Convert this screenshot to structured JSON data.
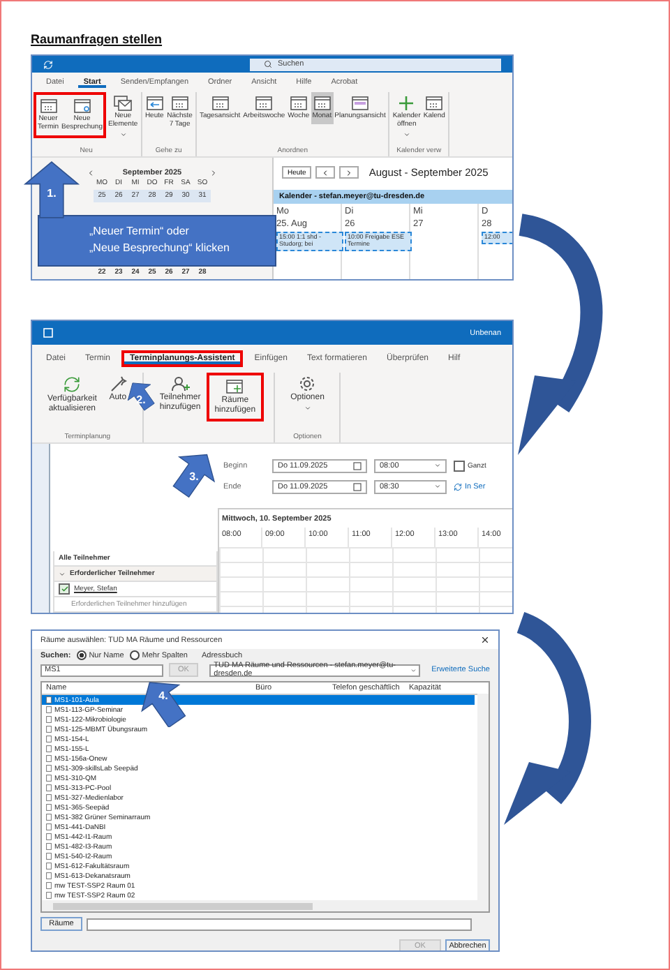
{
  "title": "Raumanfragen stellen",
  "outlook": {
    "search": {
      "placeholder": "Suchen"
    },
    "tabs": [
      {
        "label": "Datei",
        "selected": false
      },
      {
        "label": "Start",
        "selected": true
      },
      {
        "label": "Senden/Empfangen",
        "selected": false
      },
      {
        "label": "Ordner",
        "selected": false
      },
      {
        "label": "Ansicht",
        "selected": false
      },
      {
        "label": "Hilfe",
        "selected": false
      },
      {
        "label": "Acrobat",
        "selected": false
      }
    ],
    "ribbon": [
      {
        "label": "Neu",
        "buttons": [
          {
            "label": "Neuer\nTermin",
            "kind": "calendar",
            "selected": false,
            "highlighted": true
          },
          {
            "label": "Neue\nBesprechung",
            "kind": "meeting",
            "selected": false,
            "highlighted": true
          },
          {
            "label": "Neue\nElemente",
            "kind": "items",
            "selected": false,
            "highlighted": false,
            "dropdown": true
          }
        ]
      },
      {
        "label": "Gehe zu",
        "buttons": [
          {
            "label": "Heute",
            "kind": "today",
            "selected": false,
            "highlighted": false
          },
          {
            "label": "Nächste\n7 Tage",
            "kind": "calendar",
            "selected": false,
            "highlighted": false
          }
        ]
      },
      {
        "label": "Anordnen",
        "buttons": [
          {
            "label": "Tagesansicht",
            "kind": "calendar",
            "selected": false,
            "highlighted": false
          },
          {
            "label": "Arbeitswoche",
            "kind": "calendar",
            "selected": false,
            "highlighted": false
          },
          {
            "label": "Woche",
            "kind": "calendar",
            "selected": false,
            "highlighted": false
          },
          {
            "label": "Monat",
            "kind": "calendar",
            "selected": true,
            "highlighted": false
          },
          {
            "label": "Planungsansicht",
            "kind": "plan",
            "selected": false,
            "highlighted": false
          }
        ]
      },
      {
        "label": "Kalender verw",
        "buttons": [
          {
            "label": "Kalender\nöffnen",
            "kind": "add",
            "selected": false,
            "highlighted": false,
            "dropdown": true
          },
          {
            "label": "Kalend",
            "kind": "calendar",
            "selected": false,
            "highlighted": false
          }
        ]
      }
    ],
    "mini_calendar": {
      "title": "September 2025",
      "weekdays": [
        "MO",
        "DI",
        "MI",
        "DO",
        "FR",
        "SA",
        "SO"
      ],
      "weeks": [
        [
          "25",
          "26",
          "27",
          "28",
          "29",
          "30",
          "31"
        ],
        [
          "22",
          "23",
          "24",
          "25",
          "26",
          "27",
          "28"
        ]
      ]
    },
    "calendar": {
      "today_button": "Heute",
      "range": "August - September 2025",
      "account": "Kalender - stefan.meyer@tu-dresden.de",
      "days": [
        {
          "name": "Mo",
          "date": "25. Aug",
          "events": [
            "15:00 1:1 shd - Studorg; bei"
          ]
        },
        {
          "name": "Di",
          "date": "26",
          "events": [
            "10:00 Freigabe ESE Termine"
          ]
        },
        {
          "name": "Mi",
          "date": "27"
        },
        {
          "name": "D",
          "date": "28",
          "events": [
            "12:00"
          ]
        }
      ]
    }
  },
  "note": "„Neuer Termin“ oder\n„Neue Besprechung“ klicken",
  "callouts": [
    {
      "number": "1."
    },
    {
      "number": "2."
    },
    {
      "number": "3."
    },
    {
      "number": "4."
    }
  ],
  "meeting": {
    "window_title": "Unbenan",
    "tabs": [
      {
        "label": "Datei",
        "selected": false,
        "highlighted": false
      },
      {
        "label": "Termin",
        "selected": false,
        "highlighted": false
      },
      {
        "label": "Terminplanungs-Assistent",
        "selected": true,
        "highlighted": true
      },
      {
        "label": "Einfügen",
        "selected": false,
        "highlighted": false
      },
      {
        "label": "Text formatieren",
        "selected": false,
        "highlighted": false
      },
      {
        "label": "Überprüfen",
        "selected": false,
        "highlighted": false
      },
      {
        "label": "Hilf",
        "selected": false,
        "highlighted": false
      }
    ],
    "ribbon": [
      {
        "label": "Terminplanung",
        "buttons": [
          {
            "label": "Verfügbarkeit\naktualisieren",
            "kind": "refresh",
            "selected": false,
            "highlighted": false
          },
          {
            "label": "Auto",
            "kind": "wand",
            "selected": false,
            "highlighted": false
          }
        ]
      },
      {
        "buttons": [
          {
            "label": "Teilnehmer\nhinzufügen",
            "kind": "person",
            "selected": false,
            "highlighted": false
          },
          {
            "label": "Räume\nhinzufügen",
            "kind": "room",
            "selected": false,
            "highlighted": true
          }
        ]
      },
      {
        "label": "Optionen",
        "buttons": [
          {
            "label": "Optionen",
            "kind": "gear",
            "selected": false,
            "highlighted": false,
            "dropdown": true
          }
        ]
      }
    ],
    "start": {
      "label": "Beginn",
      "date": "Do 11.09.2025",
      "time": "08:00"
    },
    "end": {
      "label": "Ende",
      "date": "Do 11.09.2025",
      "time": "08:30"
    },
    "all_day": {
      "label": "Ganzt",
      "checked": false
    },
    "recurrence": "In Ser",
    "schedule": {
      "date": "Mittwoch, 10. September 2025",
      "hours": [
        "08:00",
        "09:00",
        "10:00",
        "11:00",
        "12:00",
        "13:00",
        "14:00"
      ]
    },
    "attendees": {
      "header": "Alle Teilnehmer",
      "group": {
        "label": "Erforderlicher Teilnehmer",
        "expanded": true
      },
      "people": [
        {
          "name": "Meyer, Stefan",
          "checked": true
        }
      ],
      "add_hint": "Erforderlichen Teilnehmer hinzufügen"
    }
  },
  "dialog": {
    "title": "Räume auswählen: TUD MA Räume und Ressourcen",
    "search_label": "Suchen:",
    "modes": [
      {
        "label": "Nur Name",
        "selected": true
      },
      {
        "label": "Mehr Spalten",
        "selected": false
      }
    ],
    "address_book_label": "Adressbuch",
    "query": "MS1",
    "go_button": {
      "label": "OK",
      "disabled": true
    },
    "address_book": "TUD MA Räume und Ressourcen - stefan.meyer@tu-dresden.de",
    "advanced_link": "Erweiterte Suche",
    "columns": [
      "Name",
      "Büro",
      "Telefon geschäftlich",
      "Kapazität"
    ],
    "rooms": [
      {
        "name": "MS1-101-Aula",
        "selected": true
      },
      {
        "name": "MS1-113-GP-Seminar",
        "selected": false
      },
      {
        "name": "MS1-122-Mikrobiologie",
        "selected": false
      },
      {
        "name": "MS1-125-MBMT Übungsraum",
        "selected": false
      },
      {
        "name": "MS1-154-L",
        "selected": false
      },
      {
        "name": "MS1-155-L",
        "selected": false
      },
      {
        "name": "MS1-156a-Onew",
        "selected": false
      },
      {
        "name": "MS1-309-skillsLab Seepäd",
        "selected": false
      },
      {
        "name": "MS1-310-QM",
        "selected": false
      },
      {
        "name": "MS1-313-PC-Pool",
        "selected": false
      },
      {
        "name": "MS1-327-Medienlabor",
        "selected": false
      },
      {
        "name": "MS1-365-Seepäd",
        "selected": false
      },
      {
        "name": "MS1-382 Grüner Seminarraum",
        "selected": false
      },
      {
        "name": "MS1-441-DaNBI",
        "selected": false
      },
      {
        "name": "MS1-442-I1-Raum",
        "selected": false
      },
      {
        "name": "MS1-482-I3-Raum",
        "selected": false
      },
      {
        "name": "MS1-540-I2-Raum",
        "selected": false
      },
      {
        "name": "MS1-612-Fakultätsraum",
        "selected": false
      },
      {
        "name": "MS1-613-Dekanatsraum",
        "selected": false
      },
      {
        "name": "mw TEST-SSP2 Raum 01",
        "selected": false
      },
      {
        "name": "mw TEST-SSP2 Raum 02",
        "selected": false
      }
    ],
    "rooms_button": "Räume",
    "ok_button": {
      "label": "OK",
      "disabled": true
    },
    "cancel_button": "Abbrechen"
  }
}
